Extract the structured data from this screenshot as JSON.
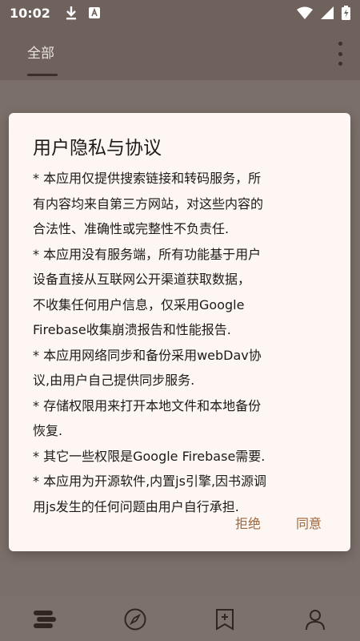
{
  "status_bar": {
    "time": "10:02",
    "icons_left": [
      "download-icon",
      "a-badge-icon"
    ],
    "icons_right": [
      "wifi-icon",
      "signal-icon",
      "battery-icon"
    ]
  },
  "app_bar": {
    "tab_label": "全部",
    "menu_icon": "more-vert-icon"
  },
  "dialog": {
    "title": "用户隐私与协议",
    "lines": [
      "* 本应用仅提供搜索链接和转码服务，所",
      "有内容均来自第三方网站，对这些内容的",
      "合法性、准确性或完整性不负责任.",
      "* 本应用没有服务端，所有功能基于用户",
      "设备直接从互联网公开渠道获取数据，",
      "不收集任何用户信息，仅采用Google",
      "Firebase收集崩溃报告和性能报告.",
      "* 本应用网络同步和备份采用webDav协",
      "议,由用户自己提供同步服务.",
      "* 存储权限用来打开本地文件和本地备份",
      "恢复.",
      "* 其它一些权限是Google Firebase需要.",
      "* 本应用为开源软件,内置js引擎,因书源调",
      "用js发生的任何问题由用户自行承担."
    ],
    "reject_label": "拒绝",
    "agree_label": "同意"
  },
  "bottom_nav": [
    "bookshelf-icon",
    "explore-icon",
    "bookmark-add-icon",
    "profile-icon"
  ],
  "colors": {
    "accent": "#a0673b",
    "dialog_bg": "#fdf6f2",
    "scrim": "#7b6f6a",
    "app_bar": "#6f625c"
  }
}
